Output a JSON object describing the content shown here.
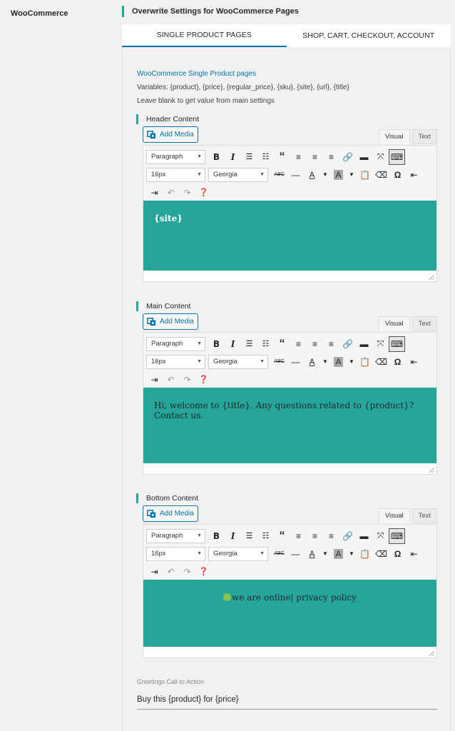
{
  "sidebar": {
    "label": "WooCommerce"
  },
  "section": {
    "title": "Overwrite Settings for WooCommerce Pages"
  },
  "tabs": [
    {
      "label": "SINGLE PRODUCT PAGES",
      "active": true
    },
    {
      "label": "SHOP, CART, CHECKOUT, ACCOUNT",
      "active": false
    }
  ],
  "intro": {
    "heading": "WooCommerce Single Product pages",
    "variables": "Variables: {product}, {price}, {regular_price}, {sku}, {site}, {url}, {title}",
    "note": "Leave blank to get value from main settings"
  },
  "editor_common": {
    "add_media": "Add Media",
    "visual": "Visual",
    "text": "Text",
    "format": "Paragraph",
    "size": "16px",
    "font": "Georgia"
  },
  "editors": [
    {
      "label": "Header Content",
      "content": "{site}",
      "bold": true,
      "align": "left"
    },
    {
      "label": "Main Content",
      "content": "Hi, welcome to {title}. Any questions related to {product}? Contact us.",
      "bold": false,
      "align": "left"
    },
    {
      "label": "Bottom Content",
      "content": "we are online| privacy policy",
      "bold": false,
      "align": "center"
    }
  ],
  "greetings": {
    "label": "Greetings Call to Action",
    "value": "Buy this {product} for {price}"
  },
  "colors": {
    "accent": "#26a69a",
    "link": "#0073aa"
  }
}
